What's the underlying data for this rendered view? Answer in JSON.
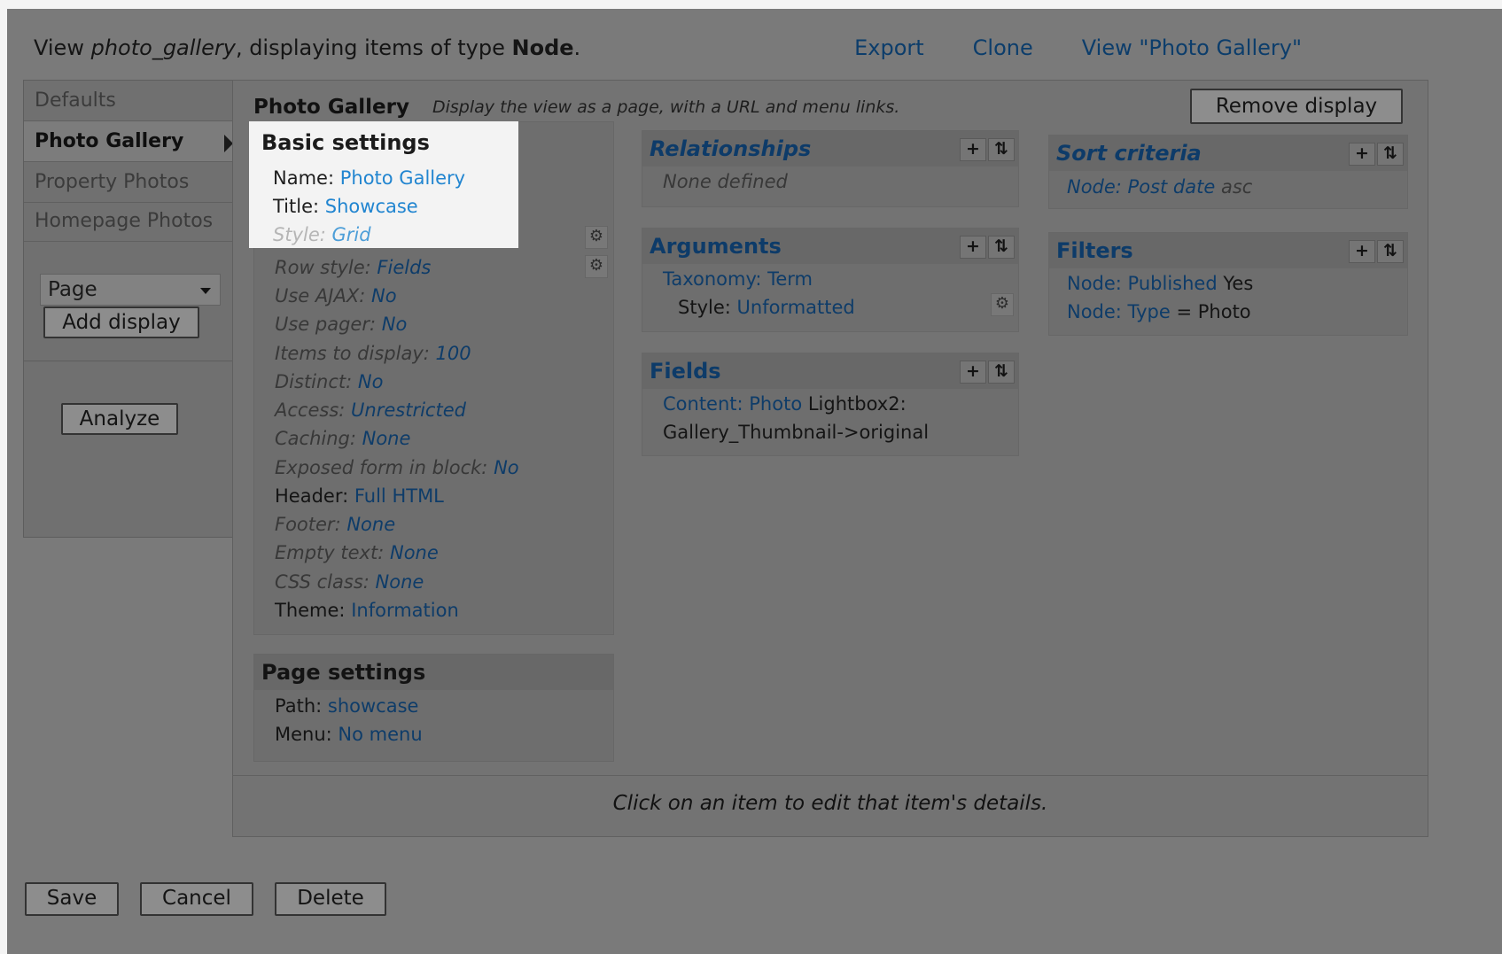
{
  "header": {
    "prefix": "View ",
    "view_name": "photo_gallery",
    "middle": ", displaying items of type ",
    "type": "Node",
    "suffix": ".",
    "links": [
      "Export",
      "Clone",
      "View \"Photo Gallery\""
    ]
  },
  "tabs": [
    "Defaults",
    "Photo Gallery",
    "Property Photos",
    "Homepage Photos"
  ],
  "display_select": "Page",
  "add_display": "Add display",
  "analyze": "Analyze",
  "display": {
    "title": "Photo Gallery",
    "description": "Display the view as a page, with a URL and menu links.",
    "remove": "Remove display"
  },
  "basic_settings": {
    "heading": "Basic settings",
    "name_label": "Name:",
    "name_value": "Photo Gallery",
    "title_label": "Title:",
    "title_value": "Showcase",
    "style_label": "Style:",
    "style_value": "Grid",
    "items": [
      {
        "label": "Row style:",
        "value": "Fields"
      },
      {
        "label": "Use AJAX:",
        "value": "No"
      },
      {
        "label": "Use pager:",
        "value": "No"
      },
      {
        "label": "Items to display:",
        "value": "100"
      },
      {
        "label": "Distinct:",
        "value": "No"
      },
      {
        "label": "Access:",
        "value": "Unrestricted"
      },
      {
        "label": "Caching:",
        "value": "None"
      },
      {
        "label": "Exposed form in block:",
        "value": "No"
      },
      {
        "label": "Header:",
        "value": "Full HTML"
      },
      {
        "label": "Footer:",
        "value": "None"
      },
      {
        "label": "Empty text:",
        "value": "None"
      },
      {
        "label": "CSS class:",
        "value": "None"
      },
      {
        "label": "Theme:",
        "value": "Information"
      }
    ]
  },
  "page_settings": {
    "heading": "Page settings",
    "path_label": "Path:",
    "path_value": "showcase",
    "menu_label": "Menu:",
    "menu_value": "No menu"
  },
  "relationships": {
    "heading": "Relationships",
    "empty": "None defined"
  },
  "arguments": {
    "heading": "Arguments",
    "item": "Taxonomy: Term",
    "style_label": "Style:",
    "style_value": "Unformatted"
  },
  "fields": {
    "heading": "Fields",
    "item": "Content: Photo",
    "item_rest": " Lightbox2:",
    "line2": "Gallery_Thumbnail->original"
  },
  "sort": {
    "heading": "Sort criteria",
    "item": "Node: Post date",
    "dir": "asc"
  },
  "filters": {
    "heading": "Filters",
    "f1": "Node: Published",
    "f1v": "Yes",
    "f2": "Node: Type",
    "f2v": "= Photo"
  },
  "footer_hint": "Click on an item to edit that item's details.",
  "actions": [
    "Save",
    "Cancel",
    "Delete"
  ],
  "controls": {
    "add": "+",
    "rearrange": "⇅",
    "gear": "⚙"
  }
}
